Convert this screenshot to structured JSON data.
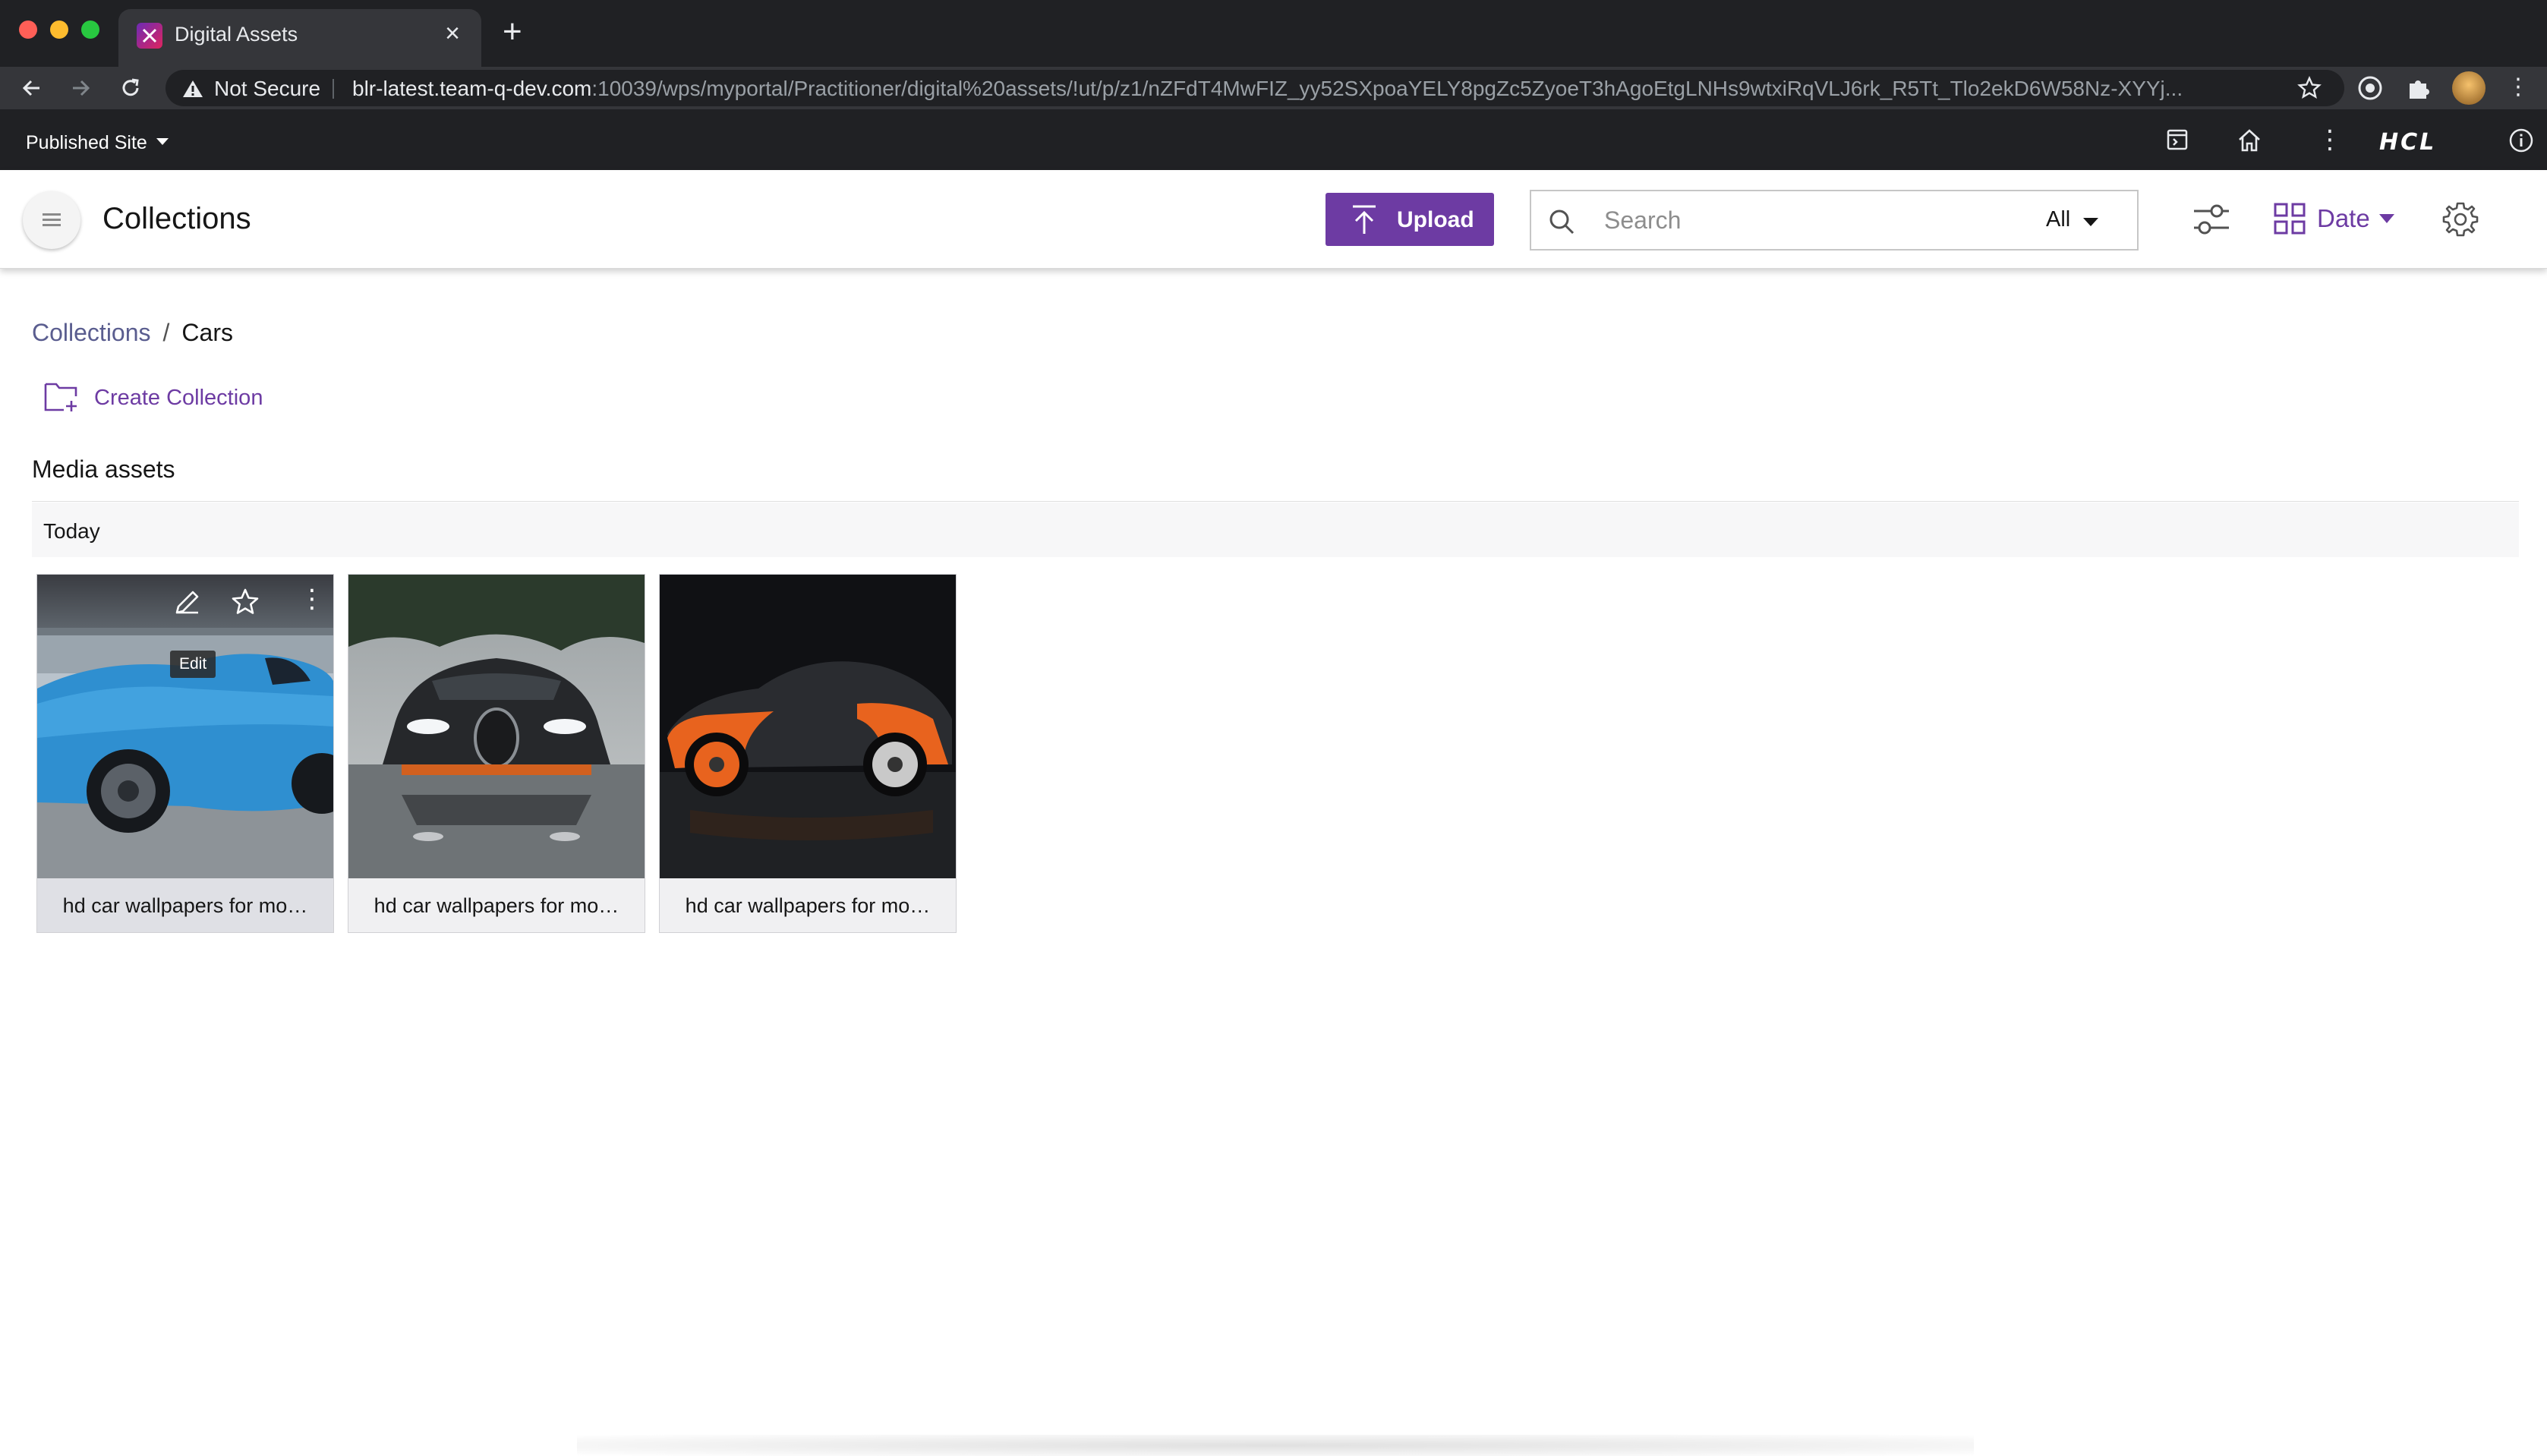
{
  "browser": {
    "tab_title": "Digital Assets",
    "security_label": "Not Secure",
    "url_host": "blr-latest.team-q-dev.com",
    "url_rest": ":10039/wps/myportal/Practitioner/digital%20assets/!ut/p/z1/nZFdT4MwFIZ_yy52SXpoaYELY8pgZc5ZyoeT3hAgoEtgLNHs9wtxiRqVLJ6rk_R5Tt_Tlo2ekD6W58Nz-XYYj..."
  },
  "portal_toolbar": {
    "site_selector": "Published Site",
    "logo_text": "HCL"
  },
  "header": {
    "title": "Collections",
    "upload_label": "Upload",
    "search_placeholder": "Search",
    "search_scope": "All",
    "sort_label": "Date"
  },
  "breadcrumb": {
    "root": "Collections",
    "separator": "/",
    "current": "Cars"
  },
  "actions": {
    "create_collection": "Create Collection"
  },
  "section": {
    "title": "Media assets",
    "group": "Today"
  },
  "assets": [
    {
      "caption": "hd car wallpapers for mo…",
      "tooltip": "Edit"
    },
    {
      "caption": "hd car wallpapers for mo…"
    },
    {
      "caption": "hd car wallpapers for mo…"
    }
  ],
  "colors": {
    "brand_purple": "#6d3ba3",
    "chrome_dark": "#202124",
    "breadcrumb_link": "#5a5d8f"
  }
}
